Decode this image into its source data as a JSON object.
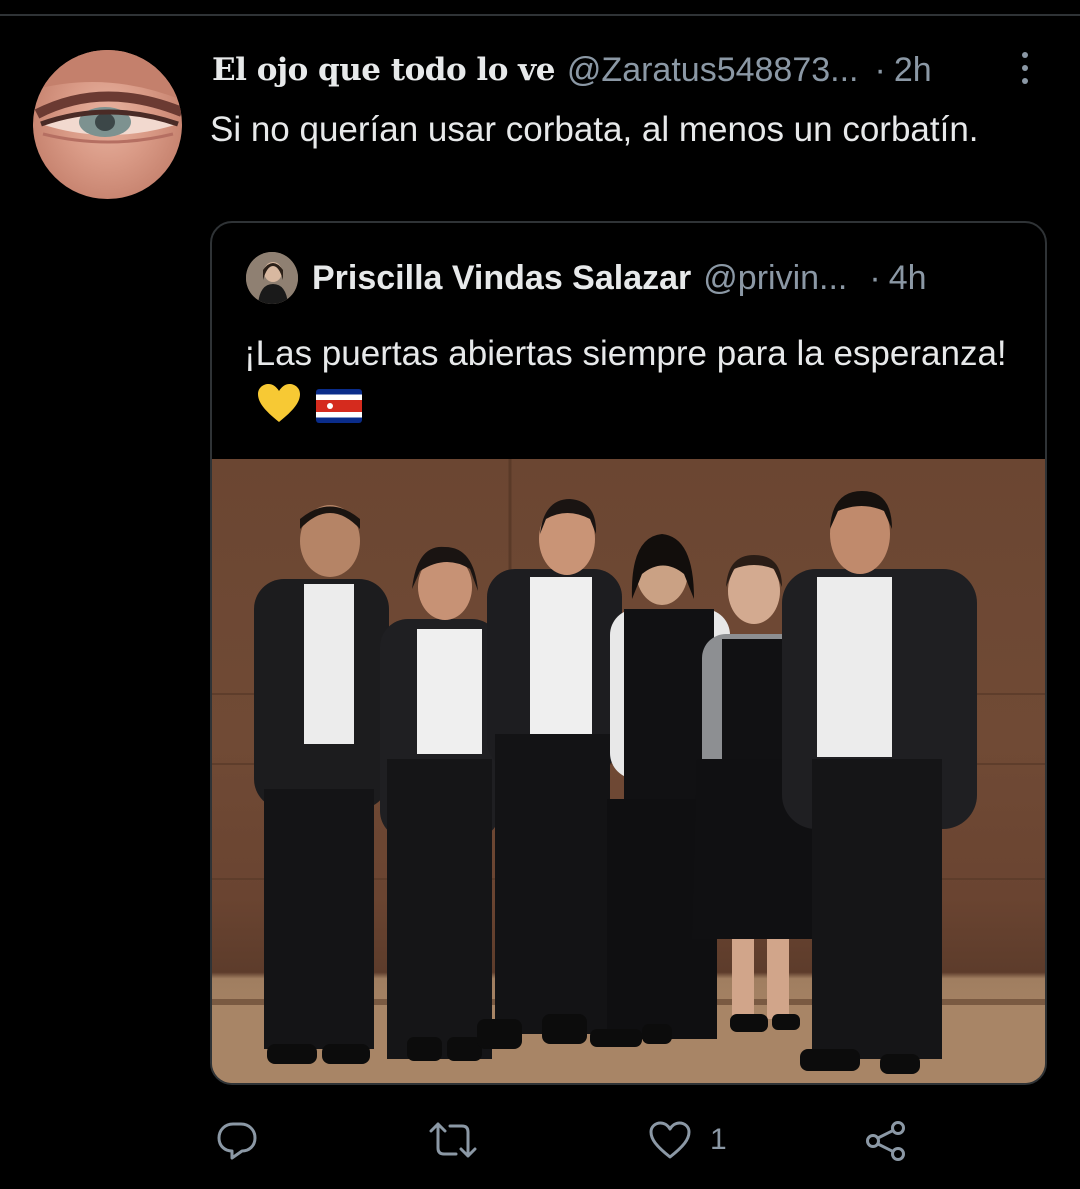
{
  "tweet": {
    "author": {
      "display_name": "El ojo que todo lo ve",
      "handle": "@Zaratus548873...",
      "avatar_icon": "eye-closeup-avatar"
    },
    "time_separator": "·",
    "time": "2h",
    "text": "Si no querían usar corbata, al menos un corbatín.",
    "more_icon": "more-vertical-icon"
  },
  "quoted_tweet": {
    "author": {
      "display_name": "Priscilla Vindas Salazar",
      "handle": "@privin...",
      "avatar_icon": "user-photo-avatar"
    },
    "time_separator": "·",
    "time": "4h",
    "text": "¡Las puertas abiertas siempre para la esperanza!",
    "emojis": [
      "yellow-heart-emoji",
      "costa-rica-flag-emoji"
    ],
    "image": "group-photo-six-people-in-black-suits"
  },
  "actions": {
    "reply_icon": "reply-icon",
    "retweet_icon": "retweet-icon",
    "like_icon": "like-icon",
    "like_count": "1",
    "share_icon": "share-icon"
  },
  "colors": {
    "background": "#000000",
    "text_primary": "#e7e9ea",
    "text_secondary": "#8b98a5",
    "border": "#2f3336"
  }
}
